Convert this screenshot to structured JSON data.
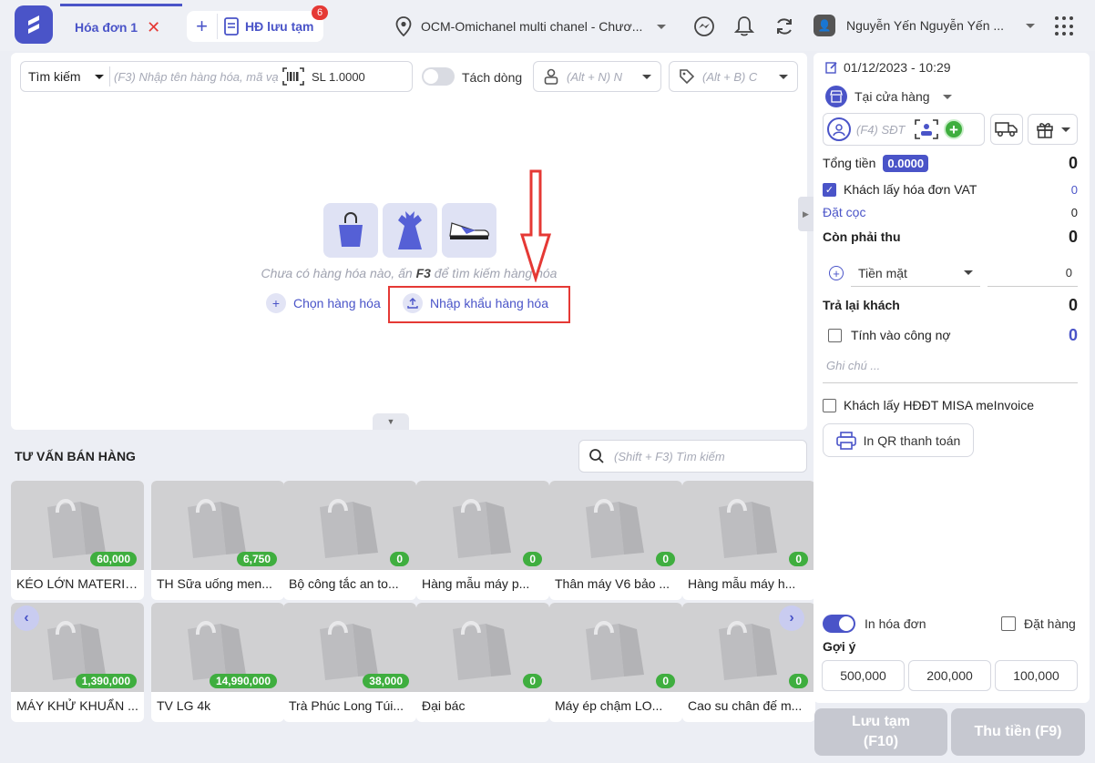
{
  "topbar": {
    "tab_active": "Hóa đơn 1",
    "tab_saved": "HĐ lưu tạm",
    "saved_count": "6",
    "store": "OCM-Omichanel multi chanel - Chươ...",
    "user": "Nguyễn Yến Nguyễn Yến ..."
  },
  "search": {
    "type": "Tìm kiếm",
    "placeholder": "(F3) Nhập tên hàng hóa, mã vạch, mã S...",
    "qty": "SL 1.0000",
    "split_label": "Tách dòng",
    "staff_placeholder": "(Alt + N) N",
    "tag_placeholder": "(Alt + B) C"
  },
  "empty": {
    "text_before": "Chưa có hàng hóa nào, ấn ",
    "key": "F3",
    "text_after": " để tìm kiếm hàng hóa",
    "choose": "Chọn hàng hóa",
    "import": "Nhập khẩu hàng hóa"
  },
  "consult": {
    "title": "TƯ VẤN BÁN HÀNG",
    "search_placeholder": "(Shift + F3) Tìm kiếm",
    "products": [
      {
        "name": "KÉO LỚN MATERIA...",
        "price": "60,000"
      },
      {
        "name": "TH Sữa uống men...",
        "price": "6,750"
      },
      {
        "name": "Bộ công tắc an to...",
        "price": "0"
      },
      {
        "name": "Hàng mẫu máy p...",
        "price": "0"
      },
      {
        "name": "Thân máy V6 bảo ...",
        "price": "0"
      },
      {
        "name": "Hàng mẫu máy h...",
        "price": "0"
      },
      {
        "name": "MÁY KHỬ KHUẨN ...",
        "price": "1,390,000"
      },
      {
        "name": "TV LG 4k",
        "price": "14,990,000"
      },
      {
        "name": "Trà Phúc Long Túi...",
        "price": "38,000"
      },
      {
        "name": "Đại bác",
        "price": "0"
      },
      {
        "name": "Máy ép chậm LO...",
        "price": "0"
      },
      {
        "name": "Cao su chân đế m...",
        "price": "0"
      }
    ]
  },
  "order": {
    "datetime": "01/12/2023 - 10:29",
    "channel": "Tại cửa hàng",
    "customer_placeholder": "(F4) SĐT",
    "total_label": "Tổng tiền",
    "total_pill": "0.0000",
    "total_value": "0",
    "vat_label": "Khách lấy hóa đơn VAT",
    "vat_value": "0",
    "deposit_label": "Đặt cọc",
    "deposit_value": "0",
    "remaining_label": "Còn phải thu",
    "remaining_value": "0",
    "payment_method": "Tiền mặt",
    "payment_value": "0",
    "change_label": "Trả lại khách",
    "change_value": "0",
    "debt_label": "Tính vào công nợ",
    "debt_value": "0",
    "note_placeholder": "Ghi chú ...",
    "misa_label": "Khách lấy HĐĐT MISA meInvoice",
    "qr_button": "In QR thanh toán",
    "print_label": "In hóa đơn",
    "reserve_label": "Đặt hàng",
    "suggest_label": "Gợi ý",
    "suggestions": [
      "500,000",
      "200,000",
      "100,000"
    ],
    "save_button": "Lưu tạm\n(F10)",
    "pay_button": "Thu tiền (F9)"
  },
  "colors": {
    "accent": "#4a54c8",
    "price_badge": "#3fae3f",
    "alert": "#e53935"
  }
}
